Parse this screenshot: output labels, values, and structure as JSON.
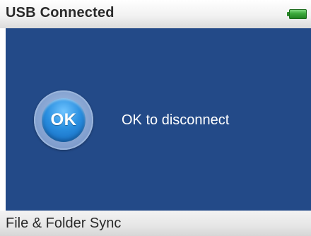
{
  "header": {
    "title": "USB Connected",
    "battery_icon": "battery-full-icon",
    "battery_color": "#3aa83a"
  },
  "main": {
    "background_color": "#234a88",
    "ok_button_label": "OK",
    "message": "OK to disconnect"
  },
  "footer": {
    "label": "File & Folder Sync"
  }
}
